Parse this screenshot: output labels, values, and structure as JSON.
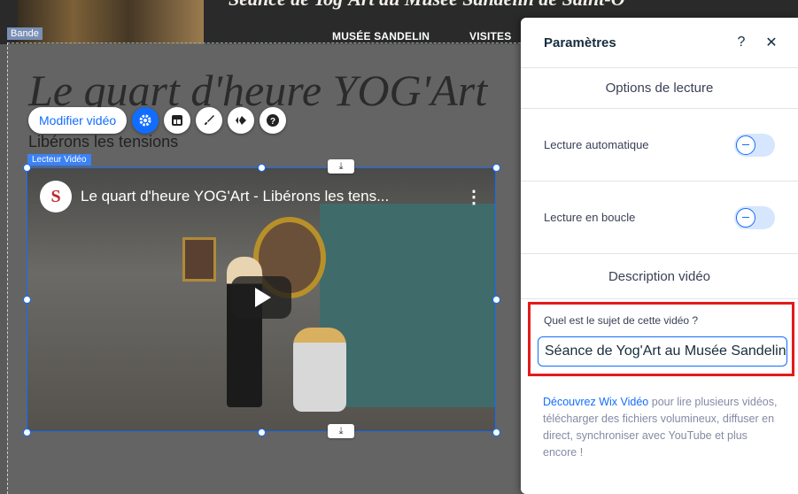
{
  "website": {
    "banner_title": "Séance de Yog'Art au Musée Sandelin de Saint-O",
    "nav": [
      "MUSÉE SANDELIN",
      "VISITES"
    ],
    "band_label": "Bande",
    "page_title": "Le quart d'heure YOG'Art",
    "subtitle": "Libérons les tensions"
  },
  "toolbar": {
    "edit_video_label": "Modifier vidéo",
    "icons": [
      "gear-icon",
      "layout-icon",
      "brush-icon",
      "animation-icon",
      "help-icon"
    ]
  },
  "player": {
    "tag_label": "Lecteur Vidéo",
    "channel_logo": "S",
    "video_title": "Le quart d'heure YOG'Art - Libérons les tens...",
    "menu_glyph": "⋮",
    "download_glyph": "⤓"
  },
  "panel": {
    "title": "Paramètres",
    "help": "?",
    "close": "✕",
    "section_playback": "Options de lecture",
    "autoplay_label": "Lecture automatique",
    "loop_label": "Lecture en boucle",
    "section_description": "Description vidéo",
    "description_question": "Quel est le sujet de cette vidéo ?",
    "description_value": "Séance de Yog'Art au Musée Sandelin de Saint-Omer",
    "info_link": "Découvrez Wix Vidéo",
    "info_text": " pour lire plusieurs vidéos, télécharger des fichiers volumineux, diffuser en direct, synchroniser avec YouTube et plus encore !"
  },
  "colors": {
    "accent": "#116dff",
    "highlight": "#e41b1b"
  }
}
